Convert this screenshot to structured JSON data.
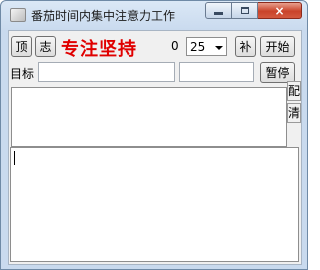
{
  "window": {
    "title": "番茄时间内集中注意力工作",
    "controls": {
      "minimize": "minimize",
      "maximize": "maximize",
      "close": "×"
    }
  },
  "toolbar": {
    "top_button": "顶",
    "log_button": "志",
    "slogan": "专注坚持",
    "count": "0",
    "duration_select": {
      "value": "25"
    },
    "add_button": "补",
    "start_button": "开始"
  },
  "goal": {
    "label": "目标",
    "input_value": "",
    "second_input_value": "",
    "pause_button": "暂停"
  },
  "side_tabs": [
    "配",
    "清"
  ],
  "editor": {
    "content": ""
  }
}
